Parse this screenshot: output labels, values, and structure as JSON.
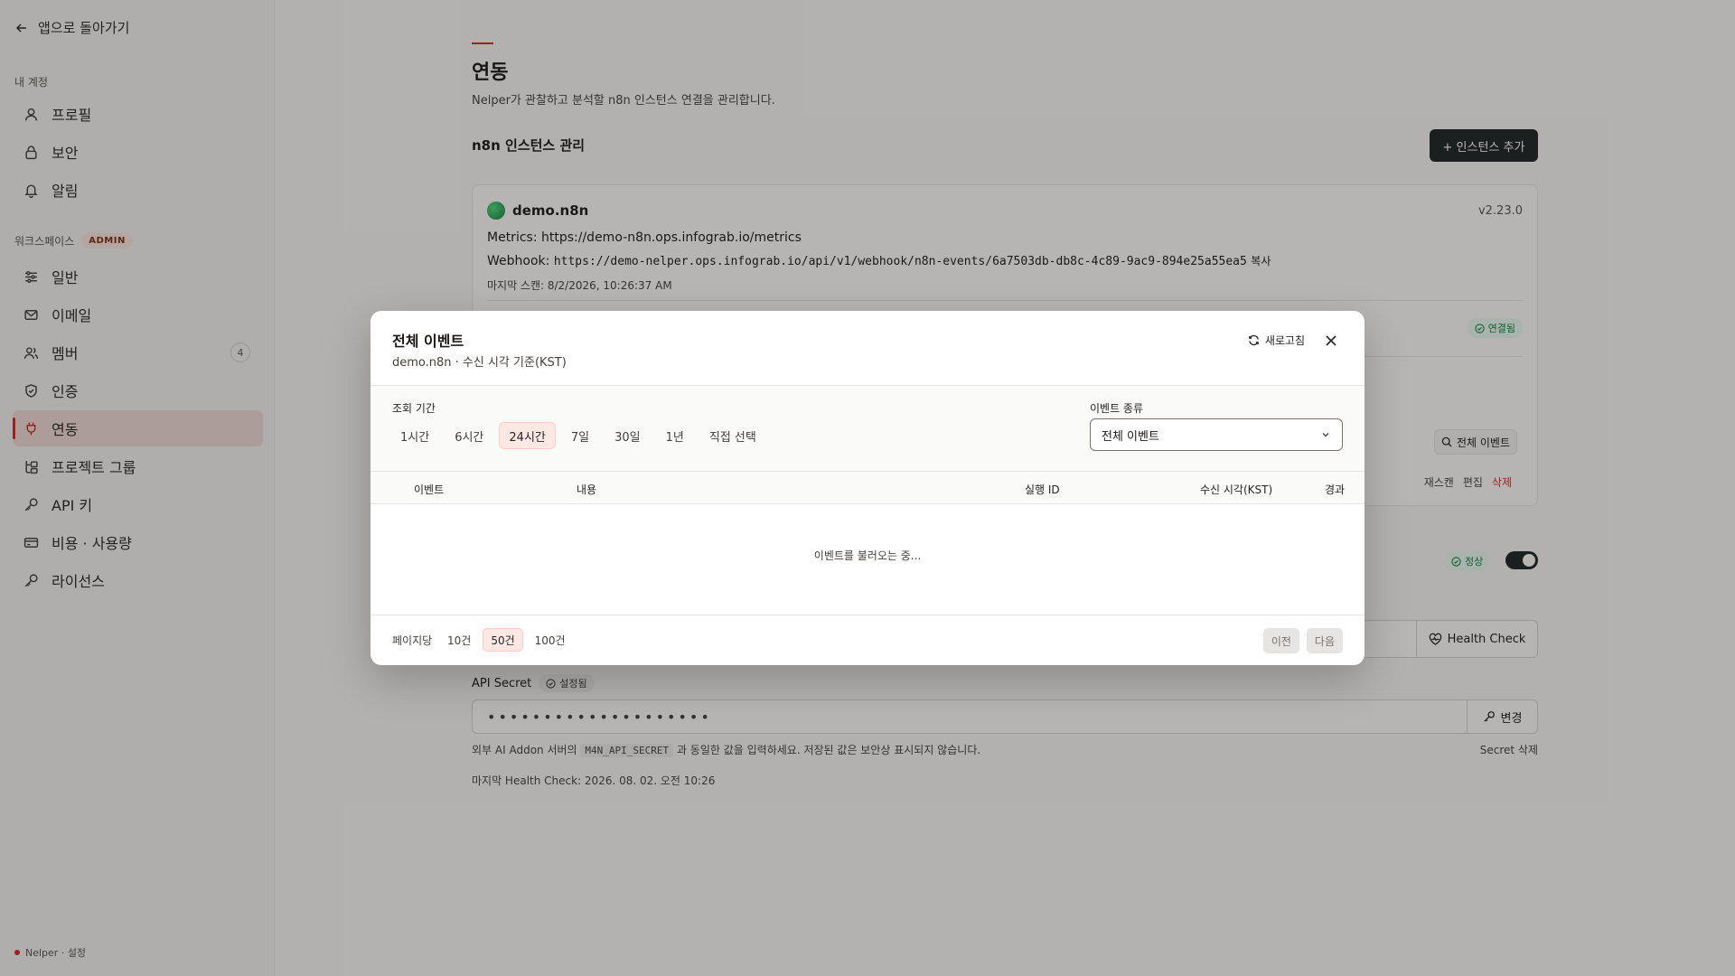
{
  "sidebar": {
    "back_label": "앱으로 돌아가기",
    "account_section": "내 계정",
    "account_items": [
      {
        "label": "프로필",
        "icon": "user-icon"
      },
      {
        "label": "보안",
        "icon": "lock-icon"
      },
      {
        "label": "알림",
        "icon": "bell-icon"
      }
    ],
    "workspace_section": "워크스페이스",
    "workspace_badge": "ADMIN",
    "workspace_items": [
      {
        "label": "일반",
        "icon": "sliders-icon"
      },
      {
        "label": "이메일",
        "icon": "mail-icon"
      },
      {
        "label": "멤버",
        "icon": "users-icon",
        "count": "4"
      },
      {
        "label": "인증",
        "icon": "shield-icon"
      },
      {
        "label": "연동",
        "icon": "plug-icon",
        "active": true
      },
      {
        "label": "프로젝트 그룹",
        "icon": "group-icon"
      },
      {
        "label": "API 키",
        "icon": "key-icon"
      },
      {
        "label": "비용 · 사용량",
        "icon": "card-icon"
      },
      {
        "label": "라이선스",
        "icon": "key-icon"
      }
    ],
    "footer": "Nelper · 설정"
  },
  "main": {
    "title": "연동",
    "description": "Nelper가 관찰하고 분석할 n8n 인스턴스 연결을 관리합니다.",
    "section_title": "n8n 인스턴스 관리",
    "add_button": "+ 인스턴스 추가",
    "instance": {
      "name": "demo.n8n",
      "version": "v2.23.0",
      "metrics_label": "Metrics:",
      "metrics_url": "https://demo-n8n.ops.infograb.io/metrics",
      "webhook_label": "Webhook:",
      "webhook_url": "https://demo-nelper.ops.infograb.io/api/v1/webhook/n8n-events/6a7503db-db8c-4c89-9ac9-894e25a55ea5",
      "copy_label": "복사",
      "last_scan": "마지막 스캔: 8/2/2026, 10:26:37 AM",
      "connected_label": "연결됨",
      "all_events_button": "전체 이벤트",
      "actions": {
        "rescan": "재스캔",
        "edit": "편집",
        "delete": "삭제"
      }
    },
    "status_label": "정상",
    "health_check_button": "Health Check",
    "api_secret_label": "API Secret",
    "api_secret_status": "설정됨",
    "api_secret_value": "••••••••••••••••••••",
    "change_button": "변경",
    "secret_hint_before": "외부 AI Addon 서버의",
    "secret_hint_code": "M4N_API_SECRET",
    "secret_hint_after": "과 동일한 값을 입력하세요. 저장된 값은 보안상 표시되지 않습니다.",
    "secret_delete": "Secret 삭제",
    "last_health_check": "마지막 Health Check: 2026. 08. 02. 오전 10:26"
  },
  "modal": {
    "title": "전체 이벤트",
    "subtitle": "demo.n8n · 수신 시각 기준(KST)",
    "refresh_label": "새로고침",
    "range_label": "조회 기간",
    "ranges": [
      "1시간",
      "6시간",
      "24시간",
      "7일",
      "30일",
      "1년",
      "직접 선택"
    ],
    "active_range_index": 2,
    "event_type_label": "이벤트 종류",
    "event_type_value": "전체 이벤트",
    "columns": {
      "event": "이벤트",
      "content": "내용",
      "execution_id": "실행 ID",
      "received_at": "수신 시각(KST)",
      "elapsed": "경과"
    },
    "loading_text": "이벤트를 불러오는 중...",
    "per_page_label": "페이지당",
    "per_page_options": [
      "10건",
      "50건",
      "100건"
    ],
    "active_per_page_index": 1,
    "prev_button": "이전",
    "next_button": "다음"
  },
  "colors": {
    "accent": "#dc2626",
    "dark_button": "#1c2224",
    "active_nav_bg": "#f2dcd9",
    "success": "#15803d"
  }
}
